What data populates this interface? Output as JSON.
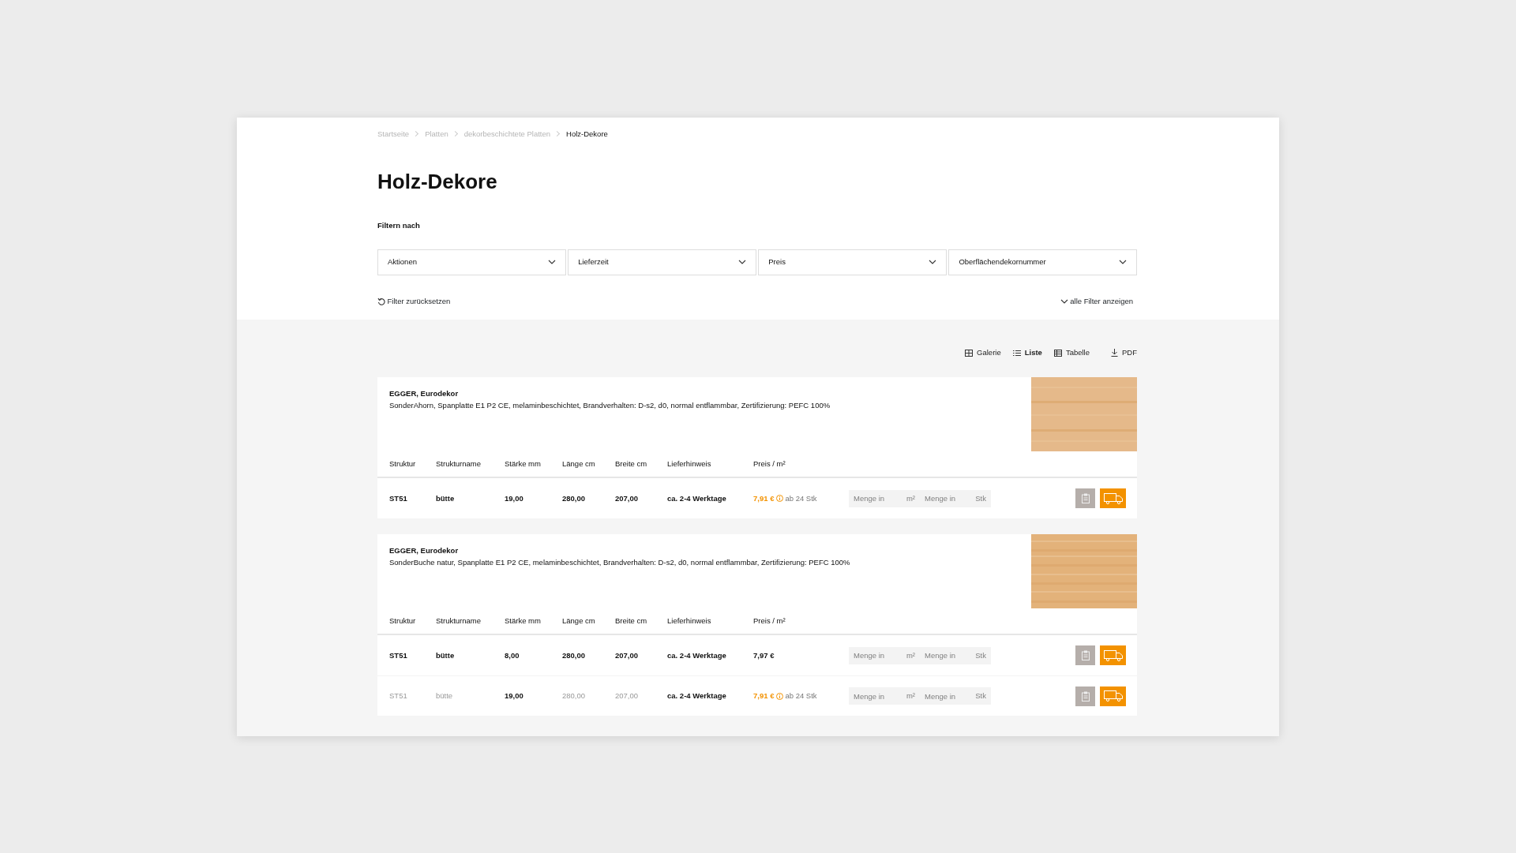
{
  "breadcrumb": [
    {
      "label": "Startseite",
      "current": false
    },
    {
      "label": "Platten",
      "current": false
    },
    {
      "label": "dekorbeschichtete Platten",
      "current": false
    },
    {
      "label": "Holz-Dekore",
      "current": true
    }
  ],
  "title": "Holz-Dekore",
  "filter_heading": "Filtern nach",
  "filters": [
    {
      "label": "Aktionen"
    },
    {
      "label": "Lieferzeit"
    },
    {
      "label": "Preis"
    },
    {
      "label": "Oberflächendekornummer"
    }
  ],
  "reset_label": "Filter zurücksetzen",
  "show_all_label": "alle Filter anzeigen",
  "views": [
    {
      "kind": "grid",
      "label": "Galerie",
      "selected": false
    },
    {
      "kind": "list",
      "label": "Liste",
      "selected": true
    },
    {
      "kind": "table",
      "label": "Tabelle",
      "selected": false
    }
  ],
  "pdf_label": "PDF",
  "products": [
    {
      "brand": "EGGER, Eurodekor",
      "description": "SonderAhorn, Spanplatte E1 P2 CE, melaminbeschichtet, Brandverhalten: D-s2, d0, normal entflammbar, Zertifizierung: PEFC 100%",
      "columns": [
        "Struktur",
        "Strukturname",
        "Stärke mm",
        "Länge cm",
        "Breite cm",
        "Lieferhinweis",
        "Preis / m²"
      ],
      "rows": [
        {
          "cells": [
            {
              "text": "ST51",
              "muted": false
            },
            {
              "text": "bütte",
              "muted": false
            },
            {
              "text": "19,00",
              "muted": false
            },
            {
              "text": "280,00",
              "muted": false
            },
            {
              "text": "207,00",
              "muted": false
            },
            {
              "text": "ca. 2-4 Werktage",
              "muted": false
            }
          ],
          "price": {
            "value": "7,91 €",
            "promo": true,
            "note": "ab 24 Stk"
          },
          "qty_fields": [
            {
              "placeholder": "Menge in",
              "unit": "m²"
            },
            {
              "placeholder": "Menge in",
              "unit": "Stk"
            }
          ]
        }
      ]
    },
    {
      "brand": "EGGER, Eurodekor",
      "description": "SonderBuche natur, Spanplatte E1 P2 CE, melaminbeschichtet, Brandverhalten: D-s2, d0, normal entflammbar, Zertifizierung: PEFC 100%",
      "columns": [
        "Struktur",
        "Strukturname",
        "Stärke mm",
        "Länge cm",
        "Breite cm",
        "Lieferhinweis",
        "Preis / m²"
      ],
      "rows": [
        {
          "cells": [
            {
              "text": "ST51",
              "muted": false
            },
            {
              "text": "bütte",
              "muted": false
            },
            {
              "text": "8,00",
              "muted": false
            },
            {
              "text": "280,00",
              "muted": false
            },
            {
              "text": "207,00",
              "muted": false
            },
            {
              "text": "ca. 2-4 Werktage",
              "muted": false
            }
          ],
          "price": {
            "value": "7,97 €",
            "promo": false
          },
          "qty_fields": [
            {
              "placeholder": "Menge in",
              "unit": "m²"
            },
            {
              "placeholder": "Menge in",
              "unit": "Stk"
            }
          ]
        },
        {
          "cells": [
            {
              "text": "ST51",
              "muted": true
            },
            {
              "text": "bütte",
              "muted": true
            },
            {
              "text": "19,00",
              "muted": false
            },
            {
              "text": "280,00",
              "muted": true
            },
            {
              "text": "207,00",
              "muted": true
            },
            {
              "text": "ca. 2-4 Werktage",
              "muted": false
            }
          ],
          "price": {
            "value": "7,91 €",
            "promo": true,
            "note": "ab 24 Stk"
          },
          "qty_fields": [
            {
              "placeholder": "Menge in",
              "unit": "m²"
            },
            {
              "placeholder": "Menge in",
              "unit": "Stk"
            }
          ]
        }
      ]
    }
  ]
}
